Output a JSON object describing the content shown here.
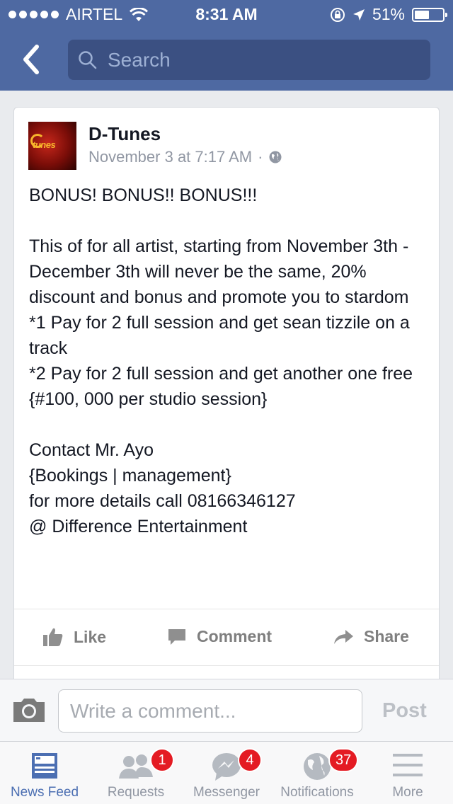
{
  "status_bar": {
    "carrier": "AIRTEL",
    "time": "8:31 AM",
    "battery": "51%",
    "battery_level": 0.51
  },
  "nav": {
    "back_icon": "chevron-left-icon",
    "search_placeholder": "Search"
  },
  "post": {
    "author": "D-Tunes",
    "avatar_text": "tunes",
    "timestamp": "November 3 at 7:17 AM",
    "separator": "·",
    "privacy_icon": "globe-icon",
    "body": [
      "BONUS! BONUS!! BONUS!!!",
      "",
      "This of for all artist, starting from November 3th - December 3th will never be the same, 20% discount and bonus and promote you to stardom",
      "*1 Pay for 2 full session and get sean tizzile on a track",
      "*2 Pay for 2 full session and get another one free",
      "{#100, 000 per studio session}",
      "",
      "Contact Mr. Ayo",
      "{Bookings | management}",
      "for more details call 08166346127",
      "@ Difference Entertainment"
    ],
    "actions": {
      "like": "Like",
      "comment": "Comment",
      "share": "Share"
    }
  },
  "comment_bar": {
    "placeholder": "Write a comment...",
    "post_label": "Post"
  },
  "tabbar": {
    "items": [
      {
        "label": "News Feed",
        "icon": "news-feed-icon",
        "badge": null,
        "active": true
      },
      {
        "label": "Requests",
        "icon": "friend-requests-icon",
        "badge": "1",
        "active": false
      },
      {
        "label": "Messenger",
        "icon": "messenger-icon",
        "badge": "4",
        "active": false
      },
      {
        "label": "Notifications",
        "icon": "globe-icon",
        "badge": "37",
        "active": false
      },
      {
        "label": "More",
        "icon": "menu-icon",
        "badge": null,
        "active": false
      }
    ]
  },
  "colors": {
    "header_blue": "#4e69a2",
    "search_blue": "#3b5082",
    "active_tab": "#4c6fb2",
    "badge_red": "#e41b23"
  }
}
